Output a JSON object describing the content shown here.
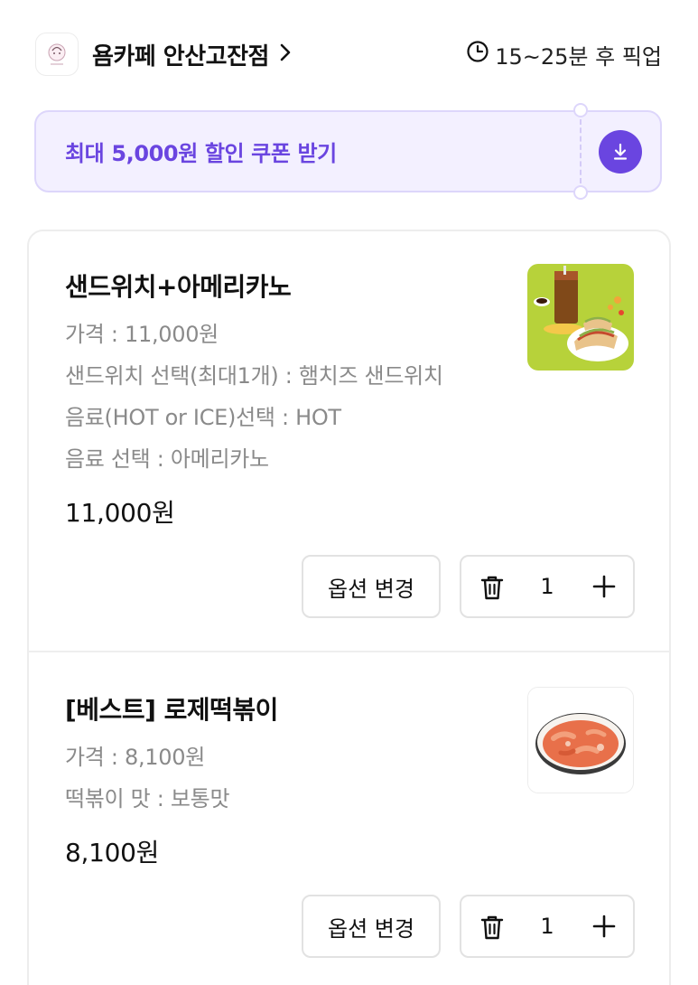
{
  "header": {
    "store_name": "욤카페 안산고잔점",
    "chevron": "›",
    "pickup_time": "15~25분 후 픽업",
    "icons": {
      "clock": "clock-icon",
      "chevron": "chevron-right-icon"
    }
  },
  "coupon": {
    "label": "최대 5,000원 할인 쿠폰 받기",
    "icon": "download-icon",
    "accent": "#6a45e0",
    "background": "#f3f0ff"
  },
  "cart": {
    "items": [
      {
        "name": "샌드위치+아메리카노",
        "options": [
          "가격 : 11,000원",
          "샌드위치 선택(최대1개) : 햄치즈 샌드위치",
          "음료(HOT or ICE)선택 : HOT",
          "음료 선택 : 아메리카노"
        ],
        "total": "11,000원",
        "change_option_label": "옵션 변경",
        "quantity": "1"
      },
      {
        "name": "[베스트] 로제떡볶이",
        "options": [
          "가격 : 8,100원",
          "떡볶이 맛 : 보통맛"
        ],
        "total": "8,100원",
        "change_option_label": "옵션 변경",
        "quantity": "1"
      }
    ]
  }
}
